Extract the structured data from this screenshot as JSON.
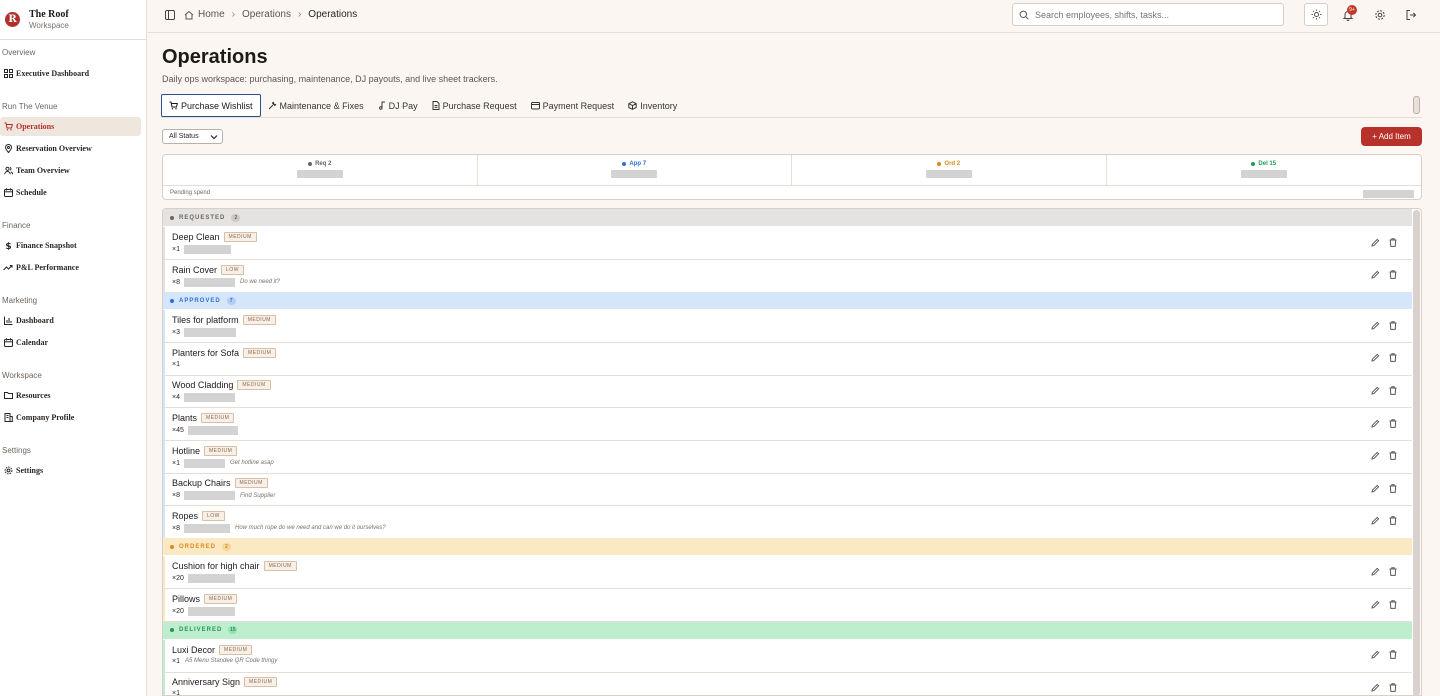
{
  "brand": {
    "name": "The Roof",
    "sub": "Workspace",
    "logo_letter": "R"
  },
  "sidebar": {
    "sections": [
      {
        "label": "Overview"
      },
      {
        "label": "Run The Venue"
      },
      {
        "label": "Finance"
      },
      {
        "label": "Marketing"
      },
      {
        "label": "Workspace"
      },
      {
        "label": "Settings"
      }
    ],
    "items": [
      {
        "label": "Executive Dashboard",
        "icon": "grid-icon"
      },
      {
        "label": "Operations",
        "icon": "cart-icon",
        "active": true
      },
      {
        "label": "Reservation Overview",
        "icon": "pin-icon"
      },
      {
        "label": "Team Overview",
        "icon": "users-icon"
      },
      {
        "label": "Schedule",
        "icon": "calendar-icon"
      },
      {
        "label": "Finance Snapshot",
        "icon": "dollar-icon"
      },
      {
        "label": "P&L Performance",
        "icon": "trend-icon"
      },
      {
        "label": "Dashboard",
        "icon": "chart-icon"
      },
      {
        "label": "Calendar",
        "icon": "calendar-icon"
      },
      {
        "label": "Resources",
        "icon": "folder-icon"
      },
      {
        "label": "Company Profile",
        "icon": "building-icon"
      },
      {
        "label": "Settings",
        "icon": "gear-icon"
      }
    ]
  },
  "breadcrumb": {
    "home": "Home",
    "parent": "Operations",
    "current": "Operations"
  },
  "search": {
    "placeholder": "Search employees, shifts, tasks..."
  },
  "notifications": {
    "badge": "9+"
  },
  "page": {
    "title": "Operations",
    "subtitle": "Daily ops workspace: purchasing, maintenance, DJ payouts, and live sheet trackers."
  },
  "tabs": [
    {
      "label": "Purchase Wishlist",
      "icon": "cart-icon",
      "active": true
    },
    {
      "label": "Maintenance & Fixes",
      "icon": "wrench-icon"
    },
    {
      "label": "DJ Pay",
      "icon": "music-icon"
    },
    {
      "label": "Purchase Request",
      "icon": "doc-icon"
    },
    {
      "label": "Payment Request",
      "icon": "card-icon"
    },
    {
      "label": "Inventory",
      "icon": "box-icon"
    }
  ],
  "filter": {
    "status_value": "All Status"
  },
  "add_button": {
    "label": "+ Add Item"
  },
  "summary": {
    "stats": [
      {
        "label": "Req 2",
        "color": "#6b6560"
      },
      {
        "label": "App 7",
        "color": "#2f6fd6"
      },
      {
        "label": "Ord 2",
        "color": "#d98a1c"
      },
      {
        "label": "Del 15",
        "color": "#1f9a55"
      }
    ],
    "pending_label": "Pending spend"
  },
  "groups": [
    {
      "title": "REQUESTED",
      "count": "2",
      "color": "#6b6560",
      "bg": "#e5e3e1",
      "count_bg": "#cfcac6",
      "items": [
        {
          "name": "Deep Clean",
          "priority": "MEDIUM",
          "qty": "×1",
          "amount_level": 0.47,
          "note": ""
        },
        {
          "name": "Rain Cover",
          "priority": "LOW",
          "qty": "×8",
          "amount_level": 0.51,
          "note": "Do we need it?"
        }
      ]
    },
    {
      "title": "APPROVED",
      "count": "7",
      "color": "#2f6fd6",
      "bg": "#d6e6fa",
      "count_bg": "#b5cff3",
      "items": [
        {
          "name": "Tiles for platform",
          "priority": "MEDIUM",
          "qty": "×3",
          "amount_level": 0.52,
          "note": ""
        },
        {
          "name": "Planters for Sofa",
          "priority": "MEDIUM",
          "qty": "×1",
          "amount_level": 0,
          "note": ""
        },
        {
          "name": "Wood Cladding",
          "priority": "MEDIUM",
          "qty": "×4",
          "amount_level": 0.51,
          "note": ""
        },
        {
          "name": "Plants",
          "priority": "MEDIUM",
          "qty": "×45",
          "amount_level": 0.5,
          "note": ""
        },
        {
          "name": "Hotline",
          "priority": "MEDIUM",
          "qty": "×1",
          "amount_level": 0.41,
          "note": "Get hotline asap"
        },
        {
          "name": "Backup Chairs",
          "priority": "MEDIUM",
          "qty": "×8",
          "amount_level": 0.51,
          "note": "Find Supplier"
        },
        {
          "name": "Ropes",
          "priority": "LOW",
          "qty": "×8",
          "amount_level": 0.46,
          "note": "How much rope do we need and can we do it ourselves?"
        }
      ]
    },
    {
      "title": "ORDERED",
      "count": "2",
      "color": "#d98a1c",
      "bg": "#fbe9c4",
      "count_bg": "#f4d79a",
      "items": [
        {
          "name": "Cushion for high chair",
          "priority": "MEDIUM",
          "qty": "×20",
          "amount_level": 0.47,
          "note": ""
        },
        {
          "name": "Pillows",
          "priority": "MEDIUM",
          "qty": "×20",
          "amount_level": 0.47,
          "note": ""
        }
      ]
    },
    {
      "title": "DELIVERED",
      "count": "15",
      "color": "#1f9a55",
      "bg": "#bfeecf",
      "count_bg": "#98dfb2",
      "items": [
        {
          "name": "Luxi Decor",
          "priority": "MEDIUM",
          "qty": "×1",
          "amount_level": 0,
          "note": "A5 Menu Standee QR Code thingy"
        },
        {
          "name": "Anniversary Sign",
          "priority": "MEDIUM",
          "qty": "×1",
          "amount_level": 0,
          "note": ""
        }
      ]
    }
  ]
}
